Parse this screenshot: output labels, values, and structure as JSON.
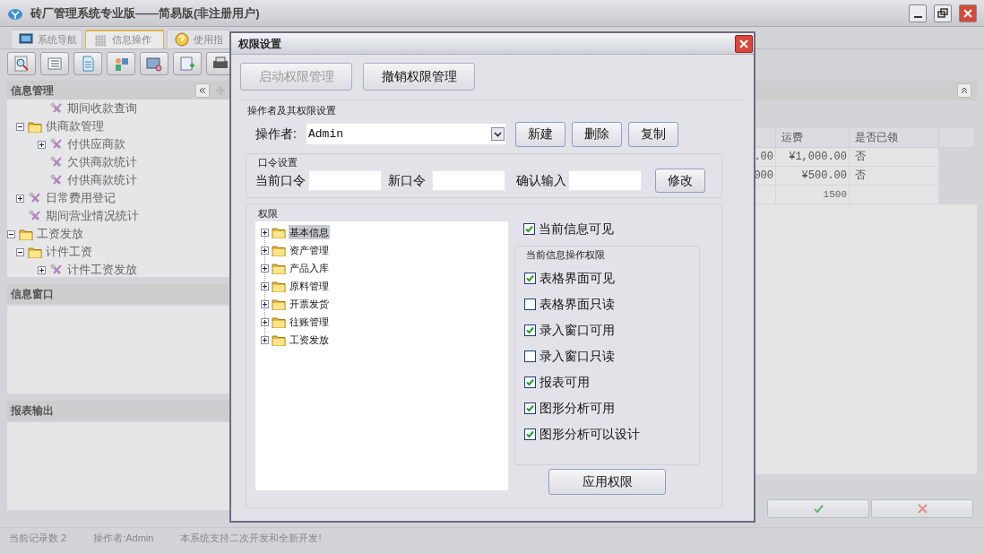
{
  "window": {
    "title": "砖厂管理系统专业版——简易版(非注册用户)"
  },
  "tabs": [
    {
      "label": "系统导航",
      "selected": false
    },
    {
      "label": "信息操作",
      "selected": true
    },
    {
      "label": "使用指",
      "selected": false
    }
  ],
  "left_panel": {
    "title": "信息管理",
    "tree": [
      {
        "children": [
          {
            "children": [
              {
                "label": "期间收款查询",
                "kind": "tool"
              }
            ]
          },
          {
            "label": "供商款管理",
            "kind": "folder",
            "expanded": true,
            "children": [
              {
                "label": "付供应商款",
                "kind": "tool",
                "expanded": false
              },
              {
                "label": "欠供商款统计",
                "kind": "tool"
              },
              {
                "label": "付供商款统计",
                "kind": "tool"
              }
            ]
          },
          {
            "label": "日常费用登记",
            "kind": "tool",
            "expanded": false
          },
          {
            "label": "期间营业情况统计",
            "kind": "tool"
          }
        ]
      },
      {
        "label": "工资发放",
        "kind": "folder",
        "expanded": true,
        "children": [
          {
            "label": "计件工资",
            "kind": "folder",
            "expanded": true,
            "children": [
              {
                "label": "计件工资发放",
                "kind": "tool",
                "expanded": false
              }
            ]
          }
        ]
      }
    ]
  },
  "info_window": {
    "title": "信息窗口"
  },
  "report_output": {
    "title": "报表输出"
  },
  "table": {
    "columns": {
      "column_2": "运费",
      "column_3": "是否已领"
    },
    "rows": [
      {
        "column_1": ".00",
        "column_2": "¥1,000.00",
        "column_3": "否"
      },
      {
        "column_1": "000",
        "column_2": "¥500.00",
        "column_3": "否"
      }
    ],
    "footer": {
      "column_2": "1500"
    }
  },
  "status_bar": [
    "当前记录数 2",
    "操作者:Admin",
    "本系统支持二次开发和全新开发!"
  ],
  "dialog": {
    "title": "权限设置",
    "top_buttons": [
      {
        "label": "启动权限管理",
        "disabled": true
      },
      {
        "label": "撤销权限管理",
        "disabled": false
      }
    ],
    "operator_group": {
      "title": "操作者及其权限设置",
      "label": "操作者:",
      "value": "Admin",
      "buttons": [
        "新建",
        "删除",
        "复制"
      ]
    },
    "password_group": {
      "title": "口令设置",
      "fields": [
        {
          "label": "当前口令"
        },
        {
          "label": "新口令"
        },
        {
          "label": "确认输入"
        }
      ],
      "button": "修改"
    },
    "rights_group": {
      "title": "权限",
      "tree": [
        {
          "label": "基本信息",
          "selected": true,
          "expanded": false
        },
        {
          "label": "资产管理",
          "selected": false,
          "expanded": false
        },
        {
          "label": "产品入库",
          "selected": false,
          "expanded": false
        },
        {
          "label": "原料管理",
          "selected": false,
          "expanded": false
        },
        {
          "label": "开票发货",
          "selected": false,
          "expanded": false
        },
        {
          "label": "往账管理",
          "selected": false,
          "expanded": false
        },
        {
          "label": "工资发放",
          "selected": false,
          "expanded": false
        }
      ],
      "visible_checkbox": {
        "label": "当前信息可见",
        "checked": true
      },
      "ops_title": "当前信息操作权限",
      "ops": [
        {
          "label": "表格界面可见",
          "checked": true
        },
        {
          "label": "表格界面只读",
          "checked": false
        },
        {
          "label": "录入窗口可用",
          "checked": true
        },
        {
          "label": "录入窗口只读",
          "checked": false
        },
        {
          "label": "报表可用",
          "checked": true
        },
        {
          "label": "图形分析可用",
          "checked": true
        },
        {
          "label": "图形分析可以设计",
          "checked": true
        }
      ],
      "apply_button": "应用权限"
    }
  }
}
